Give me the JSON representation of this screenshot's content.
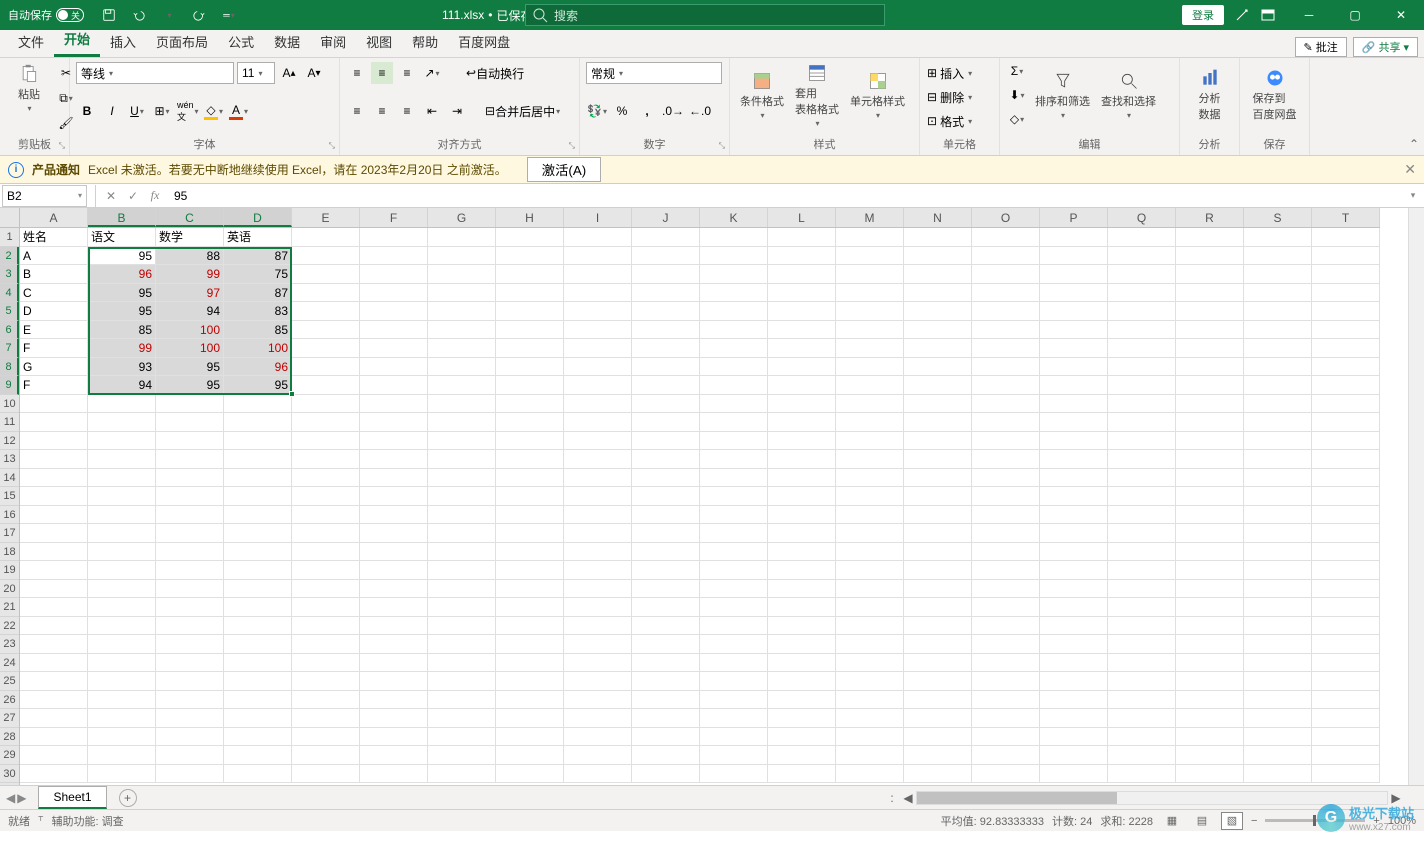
{
  "title": {
    "autosave_label": "自动保存",
    "autosave_state": "关",
    "filename": "111.xlsx",
    "saved_state": "已保存",
    "search_placeholder": "搜索",
    "login": "登录"
  },
  "tabs": {
    "items": [
      "文件",
      "开始",
      "插入",
      "页面布局",
      "公式",
      "数据",
      "审阅",
      "视图",
      "帮助",
      "百度网盘"
    ],
    "active": "开始",
    "comment": "批注",
    "share": "共享"
  },
  "ribbon": {
    "clipboard": {
      "paste": "粘贴",
      "label": "剪贴板"
    },
    "font": {
      "name": "等线",
      "size": "11",
      "label": "字体"
    },
    "align": {
      "wrap": "自动换行",
      "merge": "合并后居中",
      "label": "对齐方式"
    },
    "number": {
      "format": "常规",
      "label": "数字"
    },
    "styles": {
      "cond": "条件格式",
      "table": "套用\n表格格式",
      "cell": "单元格样式",
      "label": "样式"
    },
    "cells": {
      "insert": "插入",
      "delete": "删除",
      "format": "格式",
      "label": "单元格"
    },
    "editing": {
      "sort": "排序和筛选",
      "find": "查找和选择",
      "label": "编辑"
    },
    "analyze": {
      "btn": "分析\n数据",
      "label": "分析"
    },
    "save": {
      "btn": "保存到\n百度网盘",
      "label": "保存"
    }
  },
  "msg": {
    "heading": "产品通知",
    "text": "Excel 未激活。若要无中断地继续使用 Excel，请在 2023年2月20日 之前激活。",
    "btn": "激活(A)"
  },
  "fx": {
    "name": "B2",
    "value": "95"
  },
  "sheet": {
    "cols": [
      "A",
      "B",
      "C",
      "D",
      "E",
      "F",
      "G",
      "H",
      "I",
      "J",
      "K",
      "L",
      "M",
      "N",
      "O",
      "P",
      "Q",
      "R",
      "S",
      "T"
    ],
    "sel_cols": [
      "B",
      "C",
      "D"
    ],
    "sel_rows": [
      2,
      3,
      4,
      5,
      6,
      7,
      8,
      9
    ],
    "headers": {
      "A": "姓名",
      "B": "语文",
      "C": "数学",
      "D": "英语"
    },
    "rows": [
      {
        "A": "A",
        "B": "95",
        "C": "88",
        "D": "87"
      },
      {
        "A": "B",
        "B": "96",
        "C": "99",
        "D": "75",
        "red": [
          "B",
          "C"
        ]
      },
      {
        "A": "C",
        "B": "95",
        "C": "97",
        "D": "87",
        "red": [
          "C"
        ]
      },
      {
        "A": "D",
        "B": "95",
        "C": "94",
        "D": "83"
      },
      {
        "A": "E",
        "B": "85",
        "C": "100",
        "D": "85",
        "red": [
          "C"
        ]
      },
      {
        "A": "F",
        "B": "99",
        "C": "100",
        "D": "100",
        "red": [
          "B",
          "C",
          "D"
        ]
      },
      {
        "A": "G",
        "B": "93",
        "C": "95",
        "D": "96",
        "red": [
          "D"
        ]
      },
      {
        "A": "F",
        "B": "94",
        "C": "95",
        "D": "95"
      }
    ],
    "tab": "Sheet1"
  },
  "status": {
    "ready": "就绪",
    "acc": "辅助功能: 调查",
    "avg": "平均值: 92.83333333",
    "count": "计数: 24",
    "sum": "求和: 2228",
    "zoom": "100%"
  },
  "watermark": {
    "main": "极光下载站",
    "sub": "www.x27.com"
  }
}
